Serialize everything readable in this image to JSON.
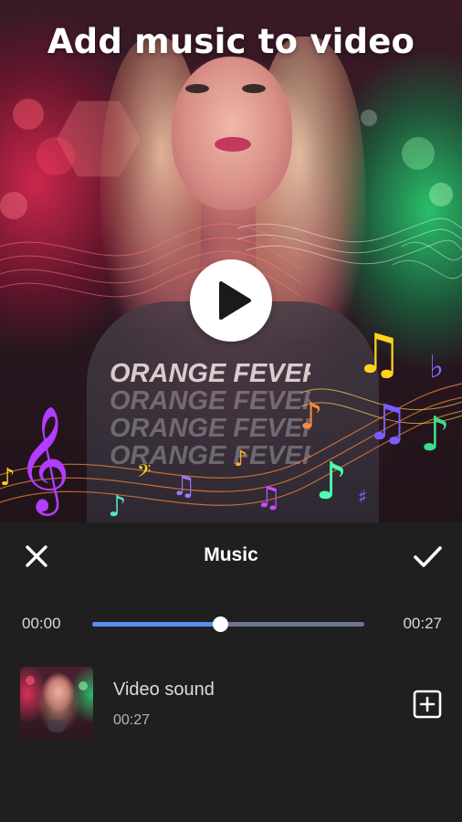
{
  "app": {
    "headline": "Add music to video"
  },
  "preview": {
    "shirt_text": "ORANGE FEVER",
    "play_icon": "play-icon"
  },
  "panel": {
    "title": "Music",
    "close_icon": "close-icon",
    "confirm_icon": "check-icon"
  },
  "player": {
    "current_time": "00:00",
    "total_time": "00:27",
    "progress": 0.47
  },
  "tracks": [
    {
      "title": "Video sound",
      "duration": "00:27",
      "action_icon": "add-box-icon"
    }
  ],
  "colors": {
    "panel_background": "#1f1f1f",
    "accent": "#5a8dee",
    "track_background": "#6b7692",
    "text_primary": "#ffffff",
    "text_secondary": "#b4b4b4"
  }
}
